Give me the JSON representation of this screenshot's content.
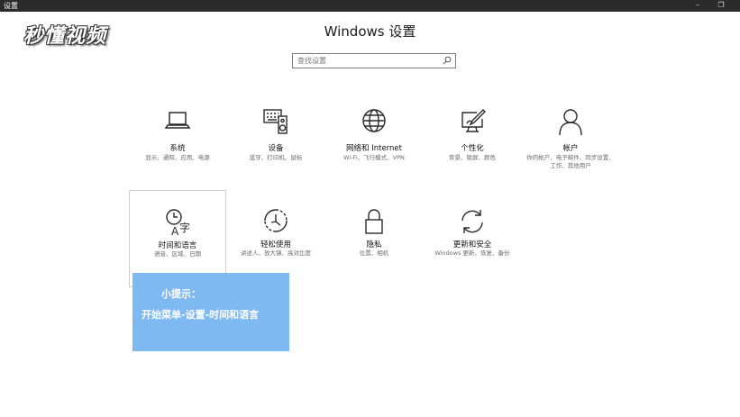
{
  "window": {
    "title": "设置",
    "minimize_glyph": "–",
    "maximize_glyph": "❐"
  },
  "watermark": "秒懂视频",
  "header": {
    "title": "Windows 设置"
  },
  "search": {
    "placeholder": "查找设置",
    "icon": "search-icon"
  },
  "tiles": [
    {
      "label": "系统",
      "desc": "显示、通知、应用、电源",
      "icon": "laptop-icon"
    },
    {
      "label": "设备",
      "desc": "蓝牙、打印机、鼠标",
      "icon": "keyboard-speaker-icon"
    },
    {
      "label": "网络和 Internet",
      "desc": "Wi-Fi、飞行模式、VPN",
      "icon": "globe-icon"
    },
    {
      "label": "个性化",
      "desc": "背景、锁屏、颜色",
      "icon": "paint-screen-icon"
    },
    {
      "label": "帐户",
      "desc": "你的帐户、电子邮件、同步设置、工作、其他用户",
      "icon": "person-icon"
    },
    {
      "label": "时间和语言",
      "desc": "语音、区域、日期",
      "icon": "clock-language-icon"
    },
    {
      "label": "轻松使用",
      "desc": "讲述人、放大镜、高对比度",
      "icon": "ease-of-access-icon"
    },
    {
      "label": "隐私",
      "desc": "位置、相机",
      "icon": "lock-icon"
    },
    {
      "label": "更新和安全",
      "desc": "Windows 更新、恢复、备份",
      "icon": "sync-icon"
    }
  ],
  "tip": {
    "title": "小提示：",
    "body": "开始菜单-设置-时间和语言"
  },
  "colors": {
    "titlebar": "#2b2b2b",
    "tip_background": "#7fb9f2",
    "icon_stroke": "#2a2a2a"
  }
}
